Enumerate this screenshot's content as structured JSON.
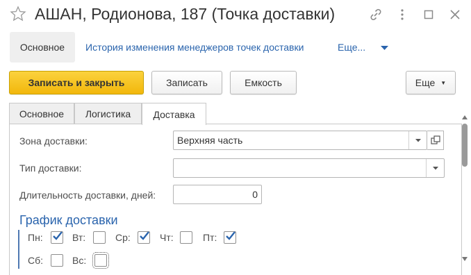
{
  "window": {
    "title": "АШАН, Родионова, 187 (Точка доставки)"
  },
  "nav": {
    "main": "Основное",
    "history_link": "История изменения менеджеров точек доставки",
    "more": "Еще..."
  },
  "toolbar": {
    "save_close": "Записать и закрыть",
    "save": "Записать",
    "capacity": "Емкость",
    "more": "Еще"
  },
  "tabs": [
    {
      "label": "Основное",
      "active": false
    },
    {
      "label": "Логистика",
      "active": false
    },
    {
      "label": "Доставка",
      "active": true
    }
  ],
  "form": {
    "zone_label": "Зона доставки:",
    "zone_value": "Верхняя часть",
    "type_label": "Тип доставки:",
    "type_value": "",
    "duration_label": "Длительность доставки, дней:",
    "duration_value": "0"
  },
  "schedule": {
    "title": "График доставки",
    "days": [
      {
        "label": "Пн:",
        "checked": true
      },
      {
        "label": "Вт:",
        "checked": false
      },
      {
        "label": "Ср:",
        "checked": true
      },
      {
        "label": "Чт:",
        "checked": false
      },
      {
        "label": "Пт:",
        "checked": true
      },
      {
        "label": "Сб:",
        "checked": false
      },
      {
        "label": "Вс:",
        "checked": false
      }
    ]
  },
  "colors": {
    "accent": "#f2b70c",
    "link": "#2a64ad"
  }
}
